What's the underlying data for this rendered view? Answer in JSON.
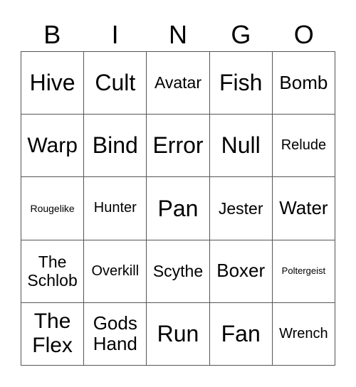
{
  "header": [
    "B",
    "I",
    "N",
    "G",
    "O"
  ],
  "cells": [
    [
      "Hive",
      "Cult",
      "Avatar",
      "Fish",
      "Bomb"
    ],
    [
      "Warp",
      "Bind",
      "Error",
      "Null",
      "Relude"
    ],
    [
      "Rougelike",
      "Hunter",
      "Pan",
      "Jester",
      "Water"
    ],
    [
      "The Schlob",
      "Overkill",
      "Scythe",
      "Boxer",
      "Poltergeist"
    ],
    [
      "The Flex",
      "Gods Hand",
      "Run",
      "Fan",
      "Wrench"
    ]
  ]
}
